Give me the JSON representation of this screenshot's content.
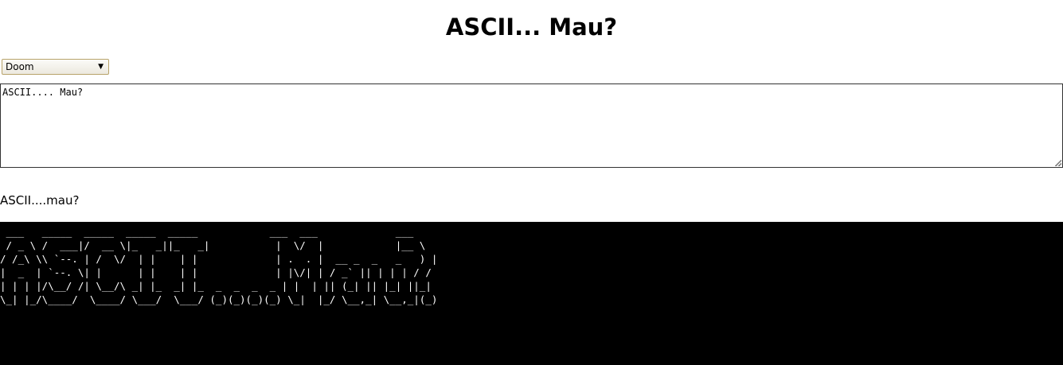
{
  "page": {
    "title": "ASCII... Mau?"
  },
  "font_select": {
    "selected": "Doom"
  },
  "input": {
    "value": "ASCII.... Mau?"
  },
  "output": {
    "caption": "ASCII....mau?",
    "ascii_art": " ___   _____  _____  _____  _____            ___  ___             ___ \n / _ \\ /  ___|/  __ \\|_   _||_   _|           |  \\/  |            |__ \\\n/ /_\\ \\\\ `--. | /  \\/  | |    | |             | .  . |  __ _  _   _   ) |\n|  _  | `--. \\| |      | |    | |             | |\\/| | / _` || | | | / / \n| | | |/\\__/ /| \\__/\\ _| |_  _| |_  _  _  _  _ | |  | || (_| || |_| ||_|  \n\\_| |_/\\____/  \\____/ \\___/  \\___/ (_)(_)(_)(_) \\_|  |_/ \\__,_| \\__,_|(_)  "
  }
}
